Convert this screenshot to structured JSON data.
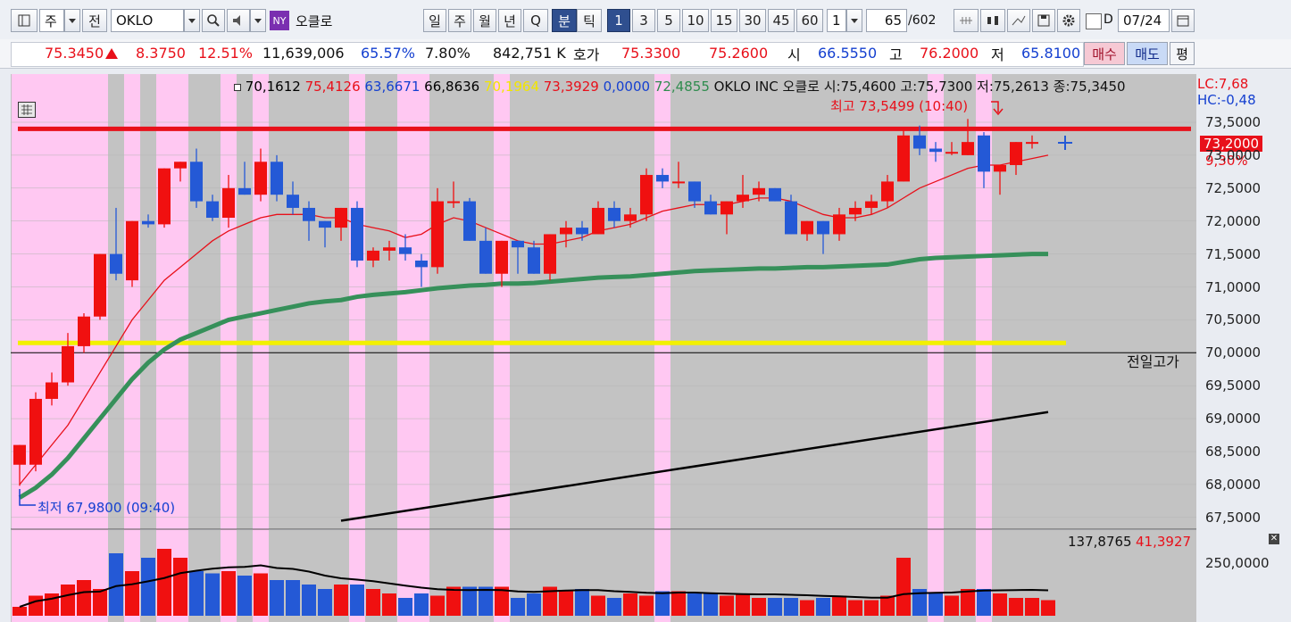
{
  "toolbar": {
    "market_sel": "주",
    "jeon_label": "전",
    "symbol": "OKLO",
    "exchange_badge": "NY",
    "name": "오클로",
    "periods": [
      "일",
      "주",
      "월",
      "년",
      "Q"
    ],
    "min_label": "분",
    "tick_label": "틱",
    "intervals": [
      "1",
      "3",
      "5",
      "10",
      "15",
      "30",
      "45",
      "60"
    ],
    "interval_value": "1",
    "count": "65",
    "total": "/602",
    "checkbox_label": "D",
    "date": "07/24"
  },
  "quote": {
    "price": "75.3450",
    "change": "8.3750",
    "change_pct": "12.51%",
    "volume": "11,639,006",
    "vol_ratio": "65.57%",
    "turnover": "7.80%",
    "amount": "842,751 K",
    "hoga_label": "호가",
    "ask": "75.3300",
    "bid": "75.2600",
    "open_label": "시",
    "open": "66.5550",
    "high_label": "고",
    "high": "76.2000",
    "low_label": "저",
    "low": "65.8100",
    "buy_label": "매수",
    "sell_label": "매도",
    "avg_label": "평"
  },
  "legend": {
    "values": [
      {
        "text": "70,1612",
        "color": "#000000"
      },
      {
        "text": "75,4126",
        "color": "#e8101a"
      },
      {
        "text": "63,6671",
        "color": "#1540d0"
      },
      {
        "text": "66,8636",
        "color": "#000000"
      },
      {
        "text": "70,1964",
        "color": "#f2e600"
      },
      {
        "text": "73,3929",
        "color": "#e8101a"
      },
      {
        "text": "0,0000",
        "color": "#1540d0"
      },
      {
        "text": "72,4855",
        "color": "#2f8c4e"
      }
    ],
    "title": "OKLO INC  오클로 시:75,4600 고:75,7300 저:75,2613 종:75,3450"
  },
  "annotations": {
    "high_label": "최고 73,5499 (10:40)",
    "low_label": "최저 67,9800 (09:40)",
    "prev_high_label": "전일고가",
    "lc": "LC:7,68",
    "hc": "HC:-0,48",
    "current_price": "73,2000",
    "current_pct": "9,30%",
    "vol_values": {
      "a": "137,8765",
      "b": "41,3927"
    }
  },
  "price_ticks": [
    "73,5000",
    "73,0000",
    "72,5000",
    "72,0000",
    "71,5000",
    "71,0000",
    "70,5000",
    "70,0000",
    "69,5000",
    "69,0000",
    "68,5000",
    "68,0000",
    "67,5000"
  ],
  "volume_tick": "250,0000",
  "chart_data": {
    "type": "candlestick",
    "ylim": [
      67.5,
      73.5
    ],
    "candles": [
      {
        "o": 68.3,
        "h": 68.6,
        "l": 67.98,
        "c": 68.6
      },
      {
        "o": 68.3,
        "h": 69.4,
        "l": 68.2,
        "c": 69.3
      },
      {
        "o": 69.3,
        "h": 69.7,
        "l": 69.2,
        "c": 69.55
      },
      {
        "o": 69.55,
        "h": 70.3,
        "l": 69.5,
        "c": 70.1
      },
      {
        "o": 70.1,
        "h": 70.6,
        "l": 70.0,
        "c": 70.55
      },
      {
        "o": 70.55,
        "h": 71.5,
        "l": 70.5,
        "c": 71.5
      },
      {
        "o": 71.5,
        "h": 72.2,
        "l": 71.1,
        "c": 71.2
      },
      {
        "o": 71.1,
        "h": 72.0,
        "l": 71.0,
        "c": 72.0
      },
      {
        "o": 72.0,
        "h": 72.1,
        "l": 71.9,
        "c": 71.95
      },
      {
        "o": 71.95,
        "h": 72.8,
        "l": 71.9,
        "c": 72.8
      },
      {
        "o": 72.8,
        "h": 72.9,
        "l": 72.6,
        "c": 72.9
      },
      {
        "o": 72.9,
        "h": 73.1,
        "l": 72.2,
        "c": 72.3
      },
      {
        "o": 72.3,
        "h": 72.4,
        "l": 72.0,
        "c": 72.05
      },
      {
        "o": 72.05,
        "h": 72.7,
        "l": 71.9,
        "c": 72.5
      },
      {
        "o": 72.5,
        "h": 72.9,
        "l": 72.4,
        "c": 72.4
      },
      {
        "o": 72.4,
        "h": 73.1,
        "l": 72.3,
        "c": 72.9
      },
      {
        "o": 72.9,
        "h": 73.0,
        "l": 72.3,
        "c": 72.4
      },
      {
        "o": 72.4,
        "h": 72.6,
        "l": 72.1,
        "c": 72.2
      },
      {
        "o": 72.2,
        "h": 72.3,
        "l": 71.7,
        "c": 72.0
      },
      {
        "o": 72.0,
        "h": 72.0,
        "l": 71.6,
        "c": 71.9
      },
      {
        "o": 71.9,
        "h": 72.2,
        "l": 71.7,
        "c": 72.2
      },
      {
        "o": 72.2,
        "h": 72.3,
        "l": 71.3,
        "c": 71.4
      },
      {
        "o": 71.4,
        "h": 71.6,
        "l": 71.3,
        "c": 71.55
      },
      {
        "o": 71.55,
        "h": 71.7,
        "l": 71.4,
        "c": 71.6
      },
      {
        "o": 71.6,
        "h": 71.8,
        "l": 71.4,
        "c": 71.5
      },
      {
        "o": 71.4,
        "h": 71.5,
        "l": 71.0,
        "c": 71.3
      },
      {
        "o": 71.3,
        "h": 72.5,
        "l": 71.2,
        "c": 72.3
      },
      {
        "o": 72.3,
        "h": 72.6,
        "l": 72.2,
        "c": 72.3
      },
      {
        "o": 72.3,
        "h": 72.35,
        "l": 71.7,
        "c": 71.7
      },
      {
        "o": 71.7,
        "h": 71.9,
        "l": 71.2,
        "c": 71.2
      },
      {
        "o": 71.2,
        "h": 71.7,
        "l": 71.0,
        "c": 71.7
      },
      {
        "o": 71.7,
        "h": 71.7,
        "l": 71.2,
        "c": 71.6
      },
      {
        "o": 71.6,
        "h": 71.7,
        "l": 71.2,
        "c": 71.2
      },
      {
        "o": 71.2,
        "h": 71.8,
        "l": 71.1,
        "c": 71.8
      },
      {
        "o": 71.8,
        "h": 72.0,
        "l": 71.6,
        "c": 71.9
      },
      {
        "o": 71.9,
        "h": 72.0,
        "l": 71.7,
        "c": 71.8
      },
      {
        "o": 71.8,
        "h": 72.3,
        "l": 71.8,
        "c": 72.2
      },
      {
        "o": 72.2,
        "h": 72.3,
        "l": 71.9,
        "c": 72.0
      },
      {
        "o": 72.0,
        "h": 72.2,
        "l": 71.9,
        "c": 72.1
      },
      {
        "o": 72.1,
        "h": 72.8,
        "l": 72.0,
        "c": 72.7
      },
      {
        "o": 72.7,
        "h": 72.8,
        "l": 72.5,
        "c": 72.6
      },
      {
        "o": 72.6,
        "h": 72.9,
        "l": 72.5,
        "c": 72.6
      },
      {
        "o": 72.6,
        "h": 72.6,
        "l": 72.2,
        "c": 72.3
      },
      {
        "o": 72.3,
        "h": 72.4,
        "l": 72.1,
        "c": 72.1
      },
      {
        "o": 72.1,
        "h": 72.3,
        "l": 71.8,
        "c": 72.3
      },
      {
        "o": 72.3,
        "h": 72.7,
        "l": 72.2,
        "c": 72.4
      },
      {
        "o": 72.4,
        "h": 72.6,
        "l": 72.3,
        "c": 72.5
      },
      {
        "o": 72.5,
        "h": 72.5,
        "l": 72.3,
        "c": 72.3
      },
      {
        "o": 72.3,
        "h": 72.4,
        "l": 71.8,
        "c": 71.8
      },
      {
        "o": 71.8,
        "h": 72.0,
        "l": 71.7,
        "c": 72.0
      },
      {
        "o": 72.0,
        "h": 72.0,
        "l": 71.5,
        "c": 71.8
      },
      {
        "o": 71.8,
        "h": 72.2,
        "l": 71.7,
        "c": 72.1
      },
      {
        "o": 72.1,
        "h": 72.3,
        "l": 72.0,
        "c": 72.2
      },
      {
        "o": 72.2,
        "h": 72.4,
        "l": 72.1,
        "c": 72.3
      },
      {
        "o": 72.3,
        "h": 72.7,
        "l": 72.2,
        "c": 72.6
      },
      {
        "o": 72.6,
        "h": 73.4,
        "l": 72.6,
        "c": 73.3
      },
      {
        "o": 73.3,
        "h": 73.45,
        "l": 73.0,
        "c": 73.1
      },
      {
        "o": 73.1,
        "h": 73.2,
        "l": 72.9,
        "c": 73.05
      },
      {
        "o": 73.05,
        "h": 73.2,
        "l": 73.0,
        "c": 73.05
      },
      {
        "o": 73.0,
        "h": 73.55,
        "l": 73.0,
        "c": 73.2
      },
      {
        "o": 73.3,
        "h": 73.35,
        "l": 72.5,
        "c": 72.75
      },
      {
        "o": 72.75,
        "h": 72.8,
        "l": 72.4,
        "c": 72.85
      },
      {
        "o": 72.85,
        "h": 73.2,
        "l": 72.7,
        "c": 73.2
      },
      {
        "o": 73.2,
        "h": 73.3,
        "l": 73.1,
        "c": 73.2
      }
    ],
    "volumes": [
      20,
      45,
      50,
      70,
      80,
      60,
      140,
      100,
      130,
      150,
      130,
      100,
      95,
      100,
      90,
      95,
      80,
      80,
      70,
      60,
      70,
      70,
      60,
      50,
      40,
      50,
      45,
      65,
      65,
      65,
      65,
      40,
      50,
      65,
      55,
      60,
      45,
      40,
      50,
      45,
      55,
      55,
      50,
      50,
      45,
      50,
      40,
      40,
      40,
      35,
      40,
      45,
      35,
      35,
      45,
      130,
      60,
      50,
      45,
      60,
      60,
      50,
      40,
      40,
      35
    ],
    "sma_red": [
      68.0,
      68.3,
      68.6,
      68.9,
      69.3,
      69.7,
      70.1,
      70.5,
      70.8,
      71.1,
      71.3,
      71.5,
      71.7,
      71.85,
      71.95,
      72.05,
      72.1,
      72.1,
      72.1,
      72.05,
      72.05,
      71.95,
      71.9,
      71.85,
      71.75,
      71.8,
      71.95,
      72.05,
      72.0,
      71.9,
      71.8,
      71.7,
      71.65,
      71.65,
      71.7,
      71.75,
      71.85,
      71.9,
      71.95,
      72.05,
      72.15,
      72.2,
      72.25,
      72.25,
      72.25,
      72.3,
      72.35,
      72.35,
      72.3,
      72.2,
      72.1,
      72.05,
      72.05,
      72.1,
      72.2,
      72.35,
      72.5,
      72.6,
      72.7,
      72.8,
      72.85,
      72.85,
      72.9,
      72.95,
      73.0
    ],
    "sma_green": [
      67.8,
      67.95,
      68.15,
      68.4,
      68.7,
      69.0,
      69.3,
      69.6,
      69.85,
      70.05,
      70.2,
      70.3,
      70.4,
      70.5,
      70.55,
      70.6,
      70.65,
      70.7,
      70.75,
      70.78,
      70.8,
      70.85,
      70.88,
      70.9,
      70.92,
      70.95,
      70.98,
      71.0,
      71.02,
      71.03,
      71.05,
      71.05,
      71.06,
      71.08,
      71.1,
      71.12,
      71.14,
      71.15,
      71.16,
      71.18,
      71.2,
      71.22,
      71.24,
      71.25,
      71.26,
      71.27,
      71.28,
      71.28,
      71.29,
      71.3,
      71.3,
      71.31,
      71.32,
      71.33,
      71.34,
      71.38,
      71.42,
      71.44,
      71.45,
      71.46,
      71.47,
      71.48,
      71.49,
      71.5,
      71.5
    ],
    "long_black": [
      [
        20,
        67.45
      ],
      [
        64,
        69.1
      ]
    ],
    "res_red": 73.4,
    "sup_yellow": 70.15,
    "prev_high": 70.0,
    "pink_cols": [
      0,
      1,
      2,
      3,
      4,
      5,
      7,
      9,
      10,
      13,
      15,
      21,
      24,
      25,
      30,
      40,
      57,
      60
    ]
  }
}
